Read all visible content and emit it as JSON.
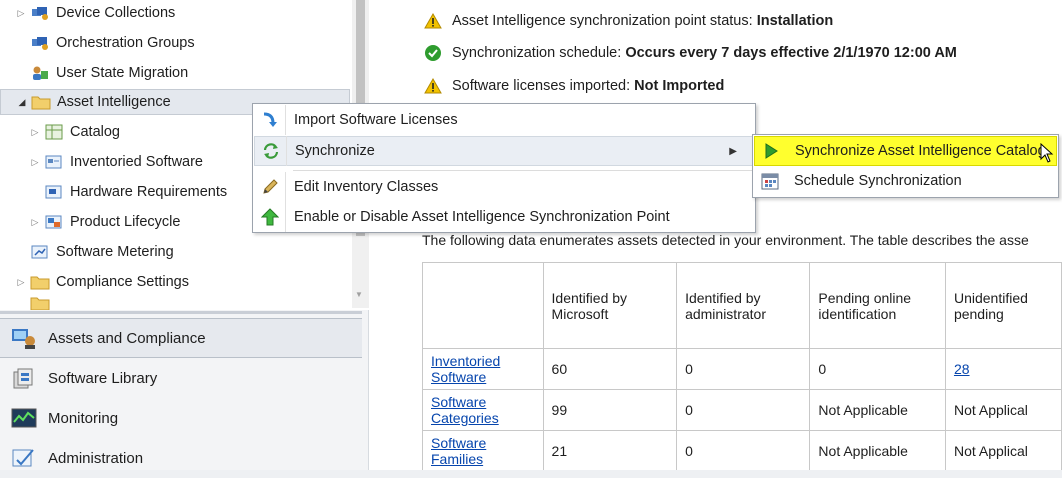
{
  "tree": {
    "items": [
      {
        "label": "Device Collections",
        "icon": "device-collections-icon",
        "expander": "collapsed"
      },
      {
        "label": "Orchestration Groups",
        "icon": "orchestration-groups-icon",
        "expander": "none"
      },
      {
        "label": "User State Migration",
        "icon": "user-state-migration-icon",
        "expander": "none"
      },
      {
        "label": "Asset Intelligence",
        "icon": "folder-icon",
        "expander": "expanded"
      },
      {
        "label": "Catalog",
        "icon": "catalog-icon",
        "expander": "collapsed"
      },
      {
        "label": "Inventoried Software",
        "icon": "inventoried-software-icon",
        "expander": "collapsed"
      },
      {
        "label": "Hardware Requirements",
        "icon": "hardware-requirements-icon",
        "expander": "none"
      },
      {
        "label": "Product Lifecycle",
        "icon": "product-lifecycle-icon",
        "expander": "collapsed"
      },
      {
        "label": "Software Metering",
        "icon": "software-metering-icon",
        "expander": "none"
      },
      {
        "label": "Compliance Settings",
        "icon": "folder-icon",
        "expander": "collapsed"
      }
    ]
  },
  "workspaces": {
    "items": [
      {
        "label": "Assets and Compliance",
        "icon": "assets-compliance-icon",
        "active": true
      },
      {
        "label": "Software Library",
        "icon": "software-library-icon",
        "active": false
      },
      {
        "label": "Monitoring",
        "icon": "monitoring-icon",
        "active": false
      },
      {
        "label": "Administration",
        "icon": "administration-icon",
        "active": false
      }
    ]
  },
  "status": {
    "sync_point_label": "Asset Intelligence synchronization point status:",
    "sync_point_value": "Installation",
    "schedule_label": "Synchronization schedule:",
    "schedule_value": "Occurs every 7 days effective 2/1/1970 12:00 AM",
    "licenses_label": "Software licenses imported:",
    "licenses_value": "Not Imported"
  },
  "description": "The following data enumerates assets detected in your environment. The table describes the asse",
  "summary_table": {
    "headers": [
      "",
      "Identified by Microsoft",
      "Identified by administrator",
      "Pending online identification",
      "Unidentified pending"
    ],
    "rows": [
      {
        "name": "Inventoried Software",
        "values": [
          "60",
          "0",
          "0",
          "28"
        ]
      },
      {
        "name": "Software Categories",
        "values": [
          "99",
          "0",
          "Not Applicable",
          "Not Applical"
        ]
      },
      {
        "name": "Software Families",
        "values": [
          "21",
          "0",
          "Not Applicable",
          "Not Applical"
        ]
      }
    ]
  },
  "context_menu": {
    "items": [
      {
        "label": "Import Software Licenses",
        "icon": "import-licenses-icon"
      },
      {
        "label": "Synchronize",
        "icon": "synchronize-icon",
        "has_submenu": true
      },
      {
        "label": "Edit Inventory Classes",
        "icon": "edit-pencil-icon"
      },
      {
        "label": "Enable or Disable Asset Intelligence Synchronization Point",
        "icon": "green-up-arrow-icon"
      }
    ]
  },
  "submenu": {
    "items": [
      {
        "label": "Synchronize Asset Intelligence Catalog",
        "icon": "green-play-icon",
        "highlighted": true
      },
      {
        "label": "Schedule Synchronization",
        "icon": "calendar-icon"
      }
    ]
  },
  "colors": {
    "highlight": "#ffff2e",
    "link": "#0645ad",
    "warning": "#f2c200",
    "ok": "#2e9c2e"
  }
}
